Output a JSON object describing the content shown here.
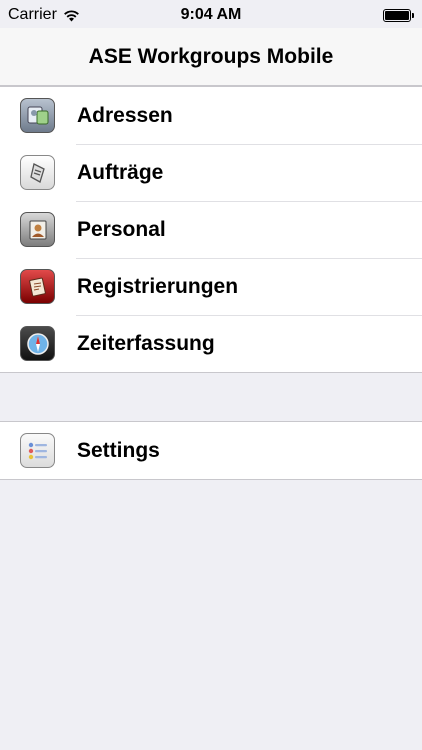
{
  "status_bar": {
    "carrier": "Carrier",
    "time": "9:04 AM"
  },
  "nav": {
    "title": "ASE Workgroups Mobile"
  },
  "menu": {
    "items": [
      {
        "label": "Adressen",
        "icon": "address-book-icon"
      },
      {
        "label": "Aufträge",
        "icon": "order-document-icon"
      },
      {
        "label": "Personal",
        "icon": "personnel-icon"
      },
      {
        "label": "Registrierungen",
        "icon": "registration-icon"
      },
      {
        "label": "Zeiterfassung",
        "icon": "compass-clock-icon"
      }
    ]
  },
  "settings": {
    "label": "Settings",
    "icon": "settings-list-icon"
  },
  "colors": {
    "background": "#efeff4",
    "nav_background": "#f7f7f7",
    "separator": "#c8c7cc"
  }
}
